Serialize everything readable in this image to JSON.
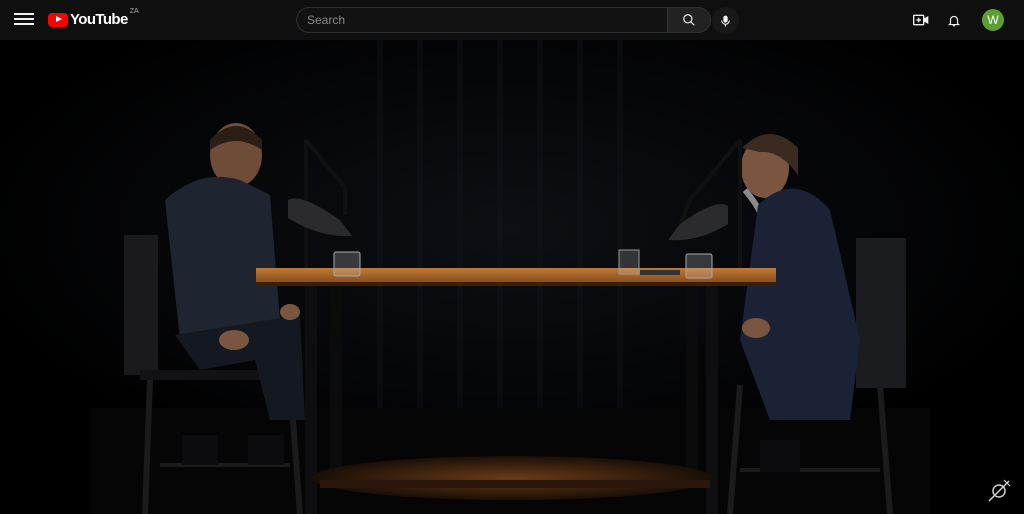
{
  "header": {
    "logo_text": "YouTube",
    "country_code": "ZA",
    "search_placeholder": "Search",
    "avatar_letter": "W"
  },
  "icons": [
    "menu-icon",
    "search-icon",
    "microphone-icon",
    "create-video-icon",
    "bell-icon"
  ],
  "colors": {
    "topbar": "#0f0f0f",
    "brand_red": "#ff0000",
    "avatar_bg": "#5c9e31",
    "table_wood": "#b06a2a"
  }
}
